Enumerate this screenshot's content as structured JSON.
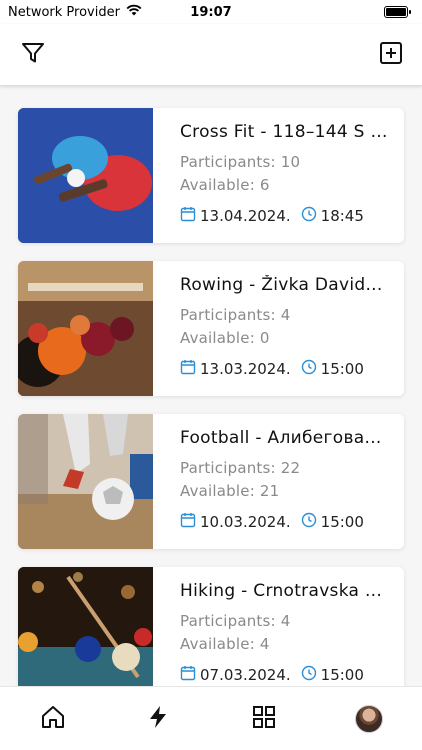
{
  "status_bar": {
    "carrier": "Network Provider",
    "time": "19:07"
  },
  "toolbar": {
    "filter_icon": "filter-icon",
    "add_icon": "add-square-icon"
  },
  "events": [
    {
      "title": "Cross Fit - 118–144 S V...",
      "participants": "Participants: 10",
      "available": "Available: 6",
      "date": "13.04.2024.",
      "time": "18:45",
      "image": "ping-pong-paddles"
    },
    {
      "title": "Rowing - Živka David...",
      "participants": "Participants: 4",
      "available": "Available: 0",
      "date": "13.03.2024.",
      "time": "15:00",
      "image": "bowling-balls"
    },
    {
      "title": "Football - Алибегова...",
      "participants": "Participants: 22",
      "available": "Available: 21",
      "date": "10.03.2024.",
      "time": "15:00",
      "image": "football-kick"
    },
    {
      "title": "Hiking - Crnotravska ...",
      "participants": "Participants: 4",
      "available": "Available: 4",
      "date": "07.03.2024.",
      "time": "15:00",
      "image": "pool-balls"
    }
  ],
  "colors": {
    "accent": "#2a8fd6",
    "card_bg": "#ffffff",
    "page_bg": "#f6f6f6"
  },
  "bottom_nav": [
    "home-icon",
    "bolt-icon",
    "grid-icon",
    "avatar"
  ]
}
